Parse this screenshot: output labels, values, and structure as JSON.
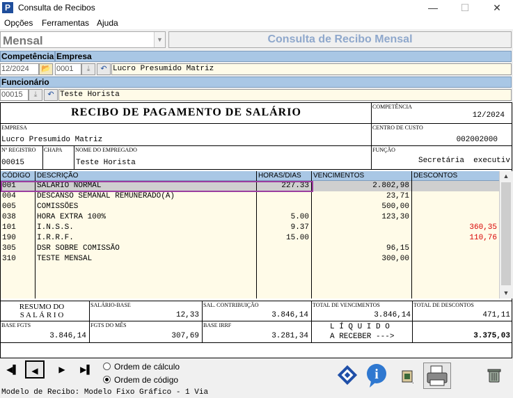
{
  "window": {
    "title": "Consulta de Recibos",
    "app_icon_letter": "P"
  },
  "menu": {
    "items": [
      "Opções",
      "Ferramentas",
      "Ajuda"
    ]
  },
  "period": {
    "value": "Mensal"
  },
  "header": {
    "title": "Consulta de Recibo Mensal"
  },
  "labels": {
    "competencia": "Competência",
    "empresa": "Empresa",
    "funcionario": "Funcionário"
  },
  "fields": {
    "competencia": "12/2024",
    "empresa_code": "0001",
    "empresa_name": "Lucro Presumido Matriz",
    "funcionario_code": "00015",
    "funcionario_name": "Teste Horista"
  },
  "receipt": {
    "title": "RECIBO DE PAGAMENTO DE SALÁRIO",
    "competencia_caption": "COMPETÊNCIA",
    "competencia": "12/2024",
    "empresa_caption": "EMPRESA",
    "empresa": "Lucro Presumido Matriz",
    "centro_custo_caption": "CENTRO DE CUSTO",
    "centro_custo": "002002000",
    "registro_caption": "Nº REGISTRO",
    "registro": "00015",
    "chapa_caption": "CHAPA",
    "nome_caption": "NOME DO EMPREGADO",
    "nome": "Teste Horista",
    "funcao_caption": "FUNÇÃO",
    "funcao": "Secretária  executiv"
  },
  "grid": {
    "columns": [
      "CÓDIGO",
      "DESCRIÇÃO",
      "HORAS/DIAS",
      "VENCIMENTOS",
      "DESCONTOS"
    ],
    "rows": [
      {
        "codigo": "001",
        "descricao": "SALÁRIO NORMAL",
        "horas": "227.33",
        "vencimentos": "2.802,98",
        "descontos": ""
      },
      {
        "codigo": "004",
        "descricao": "DESCANSO SEMANAL REMUNERADO(A)",
        "horas": "",
        "vencimentos": "23,71",
        "descontos": ""
      },
      {
        "codigo": "005",
        "descricao": "COMISSÕES",
        "horas": "",
        "vencimentos": "500,00",
        "descontos": ""
      },
      {
        "codigo": "038",
        "descricao": "HORA EXTRA 100%",
        "horas": "5.00",
        "vencimentos": "123,30",
        "descontos": ""
      },
      {
        "codigo": "101",
        "descricao": "I.N.S.S.",
        "horas": "9.37",
        "vencimentos": "",
        "descontos": "360,35"
      },
      {
        "codigo": "190",
        "descricao": "I.R.R.F.",
        "horas": "15.00",
        "vencimentos": "",
        "descontos": "110,76"
      },
      {
        "codigo": "305",
        "descricao": "DSR SOBRE COMISSÃO",
        "horas": "",
        "vencimentos": "96,15",
        "descontos": ""
      },
      {
        "codigo": "310",
        "descricao": "TESTE MENSAL",
        "horas": "",
        "vencimentos": "300,00",
        "descontos": ""
      }
    ]
  },
  "summary": {
    "resumo_line1": "RESUMO DO",
    "resumo_line2": "S A L Á R I O",
    "salario_base_caption": "SALÁRIO-BASE",
    "salario_base": "12,33",
    "sal_contribuicao_caption": "SAL. CONTRIBUIÇÃO",
    "sal_contribuicao": "3.846,14",
    "total_vencimentos_caption": "TOTAL DE VENCIMENTOS",
    "total_vencimentos": "3.846,14",
    "total_descontos_caption": "TOTAL DE DESCONTOS",
    "total_descontos": "471,11",
    "base_fgts_caption": "BASE FGTS",
    "base_fgts": "3.846,14",
    "fgts_mes_caption": "FGTS DO MÊS",
    "fgts_mes": "307,69",
    "base_irrf_caption": "BASE IRRF",
    "base_irrf": "3.281,34",
    "liquido_line1": "L Í Q U I D O",
    "liquido_line2": "A RECEBER --->",
    "liquido": "3.375,03"
  },
  "order": {
    "calculo": "Ordem de cálculo",
    "codigo": "Ordem de código",
    "selected": "codigo"
  },
  "footer": {
    "model": "Modelo de Recibo: Modelo Fixo Gráfico - 1 Via"
  }
}
